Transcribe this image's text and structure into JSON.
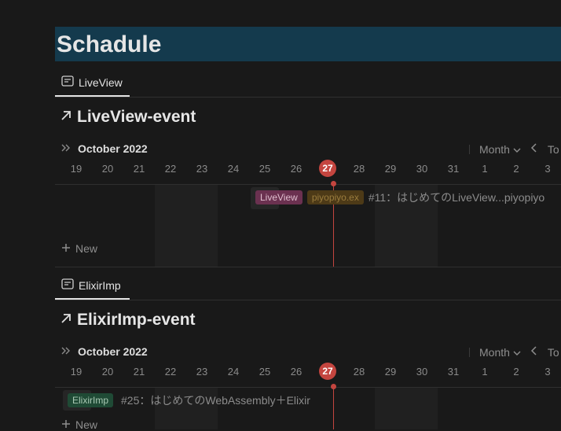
{
  "page": {
    "title": "Schadule"
  },
  "sections": [
    {
      "tab_label": "LiveView",
      "title": "LiveView-event",
      "month_label": "October 2022",
      "view_label": "Month",
      "today_label": "To",
      "new_label": "New",
      "event": {
        "tags": [
          {
            "label": "LiveView",
            "color": "#7a3a5a",
            "text_color": "#e3c3d3"
          },
          {
            "label": "piyopiyo.ex",
            "color": "#5a4419",
            "text_color": "#9c7e3e"
          }
        ],
        "title": "#11：はじめてのLiveView...piyopiyo"
      }
    },
    {
      "tab_label": "ElixirImp",
      "title": "ElixirImp-event",
      "month_label": "October 2022",
      "view_label": "Month",
      "today_label": "To",
      "new_label": "New",
      "event": {
        "tags": [
          {
            "label": "ElixirImp",
            "color": "#1f4a35",
            "text_color": "#a9c9b4"
          }
        ],
        "title": "#25：はじめてのWebAssembly＋Elixir"
      }
    }
  ],
  "days": [
    "19",
    "20",
    "21",
    "22",
    "23",
    "24",
    "25",
    "26",
    "27",
    "28",
    "29",
    "30",
    "31",
    "1",
    "2",
    "3"
  ],
  "today_day": "27",
  "colors": {
    "today": "#c4453f",
    "title_bar": "#143a4d"
  }
}
